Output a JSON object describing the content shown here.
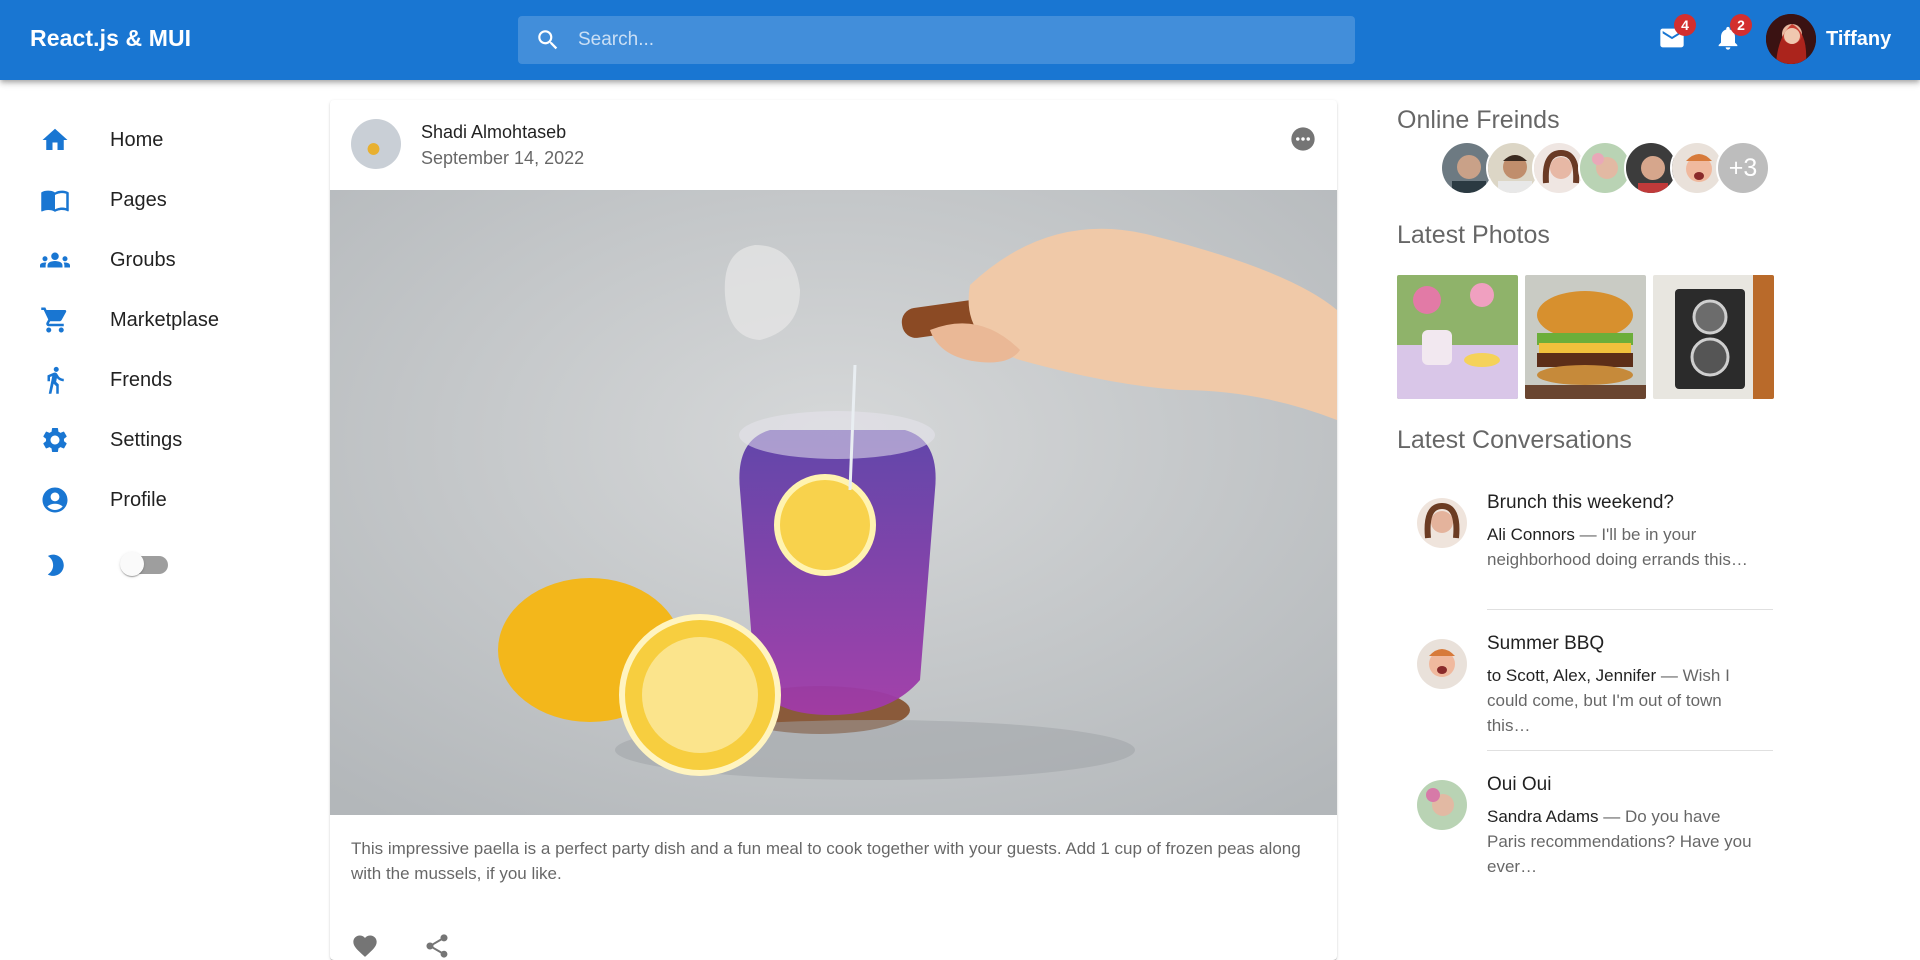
{
  "appbar": {
    "brand": "React.js & MUI",
    "search_placeholder": "Search...",
    "mail_count": "4",
    "notification_count": "2",
    "user_name": "Tiffany",
    "color": "#1976d2"
  },
  "sidebar": {
    "items": [
      {
        "label": "Home",
        "icon": "home-icon"
      },
      {
        "label": "Pages",
        "icon": "pages-icon"
      },
      {
        "label": "Groubs",
        "icon": "groups-icon"
      },
      {
        "label": "Marketplase",
        "icon": "cart-icon"
      },
      {
        "label": "Frends",
        "icon": "person-icon"
      },
      {
        "label": "Settings",
        "icon": "gear-icon"
      },
      {
        "label": "Profile",
        "icon": "account-icon"
      }
    ],
    "dark_mode_icon": "moon-icon",
    "dark_mode_on": false
  },
  "post": {
    "author": "Shadi Almohtaseb",
    "date": "September 14, 2022",
    "text": "This impressive paella is a perfect party dish and a fun meal to cook together with your guests. Add 1 cup of frozen peas along with the mussels, if you like."
  },
  "right": {
    "online_title": "Online Freinds",
    "online_more": "+3",
    "photos_title": "Latest Photos",
    "conversations_title": "Latest Conversations",
    "conversations": [
      {
        "title": "Brunch this weekend?",
        "who": "Ali Connors",
        "text": " — I'll be in your neighborhood doing errands this…"
      },
      {
        "title": "Summer BBQ",
        "who": "to Scott, Alex, Jennifer",
        "text": " — Wish I could come, but I'm out of town this…"
      },
      {
        "title": "Oui Oui",
        "who": "Sandra Adams",
        "text": " — Do you have Paris recommendations? Have you ever…"
      }
    ]
  }
}
